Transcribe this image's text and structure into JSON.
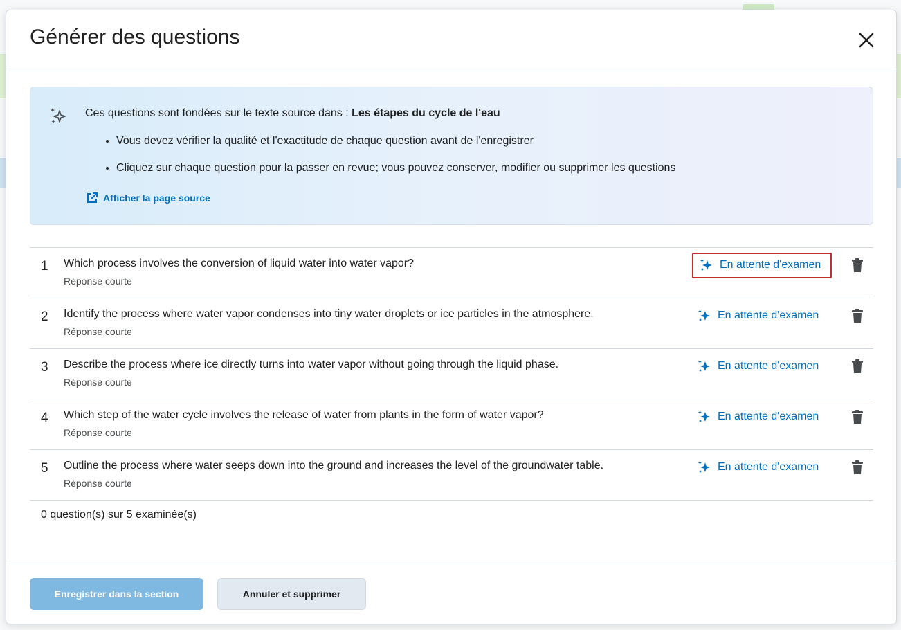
{
  "dialog": {
    "title": "Générer des questions",
    "close_label": "×"
  },
  "notice": {
    "intro": "Ces questions sont fondées sur le texte source dans : ",
    "source_name": "Les étapes du cycle de l'eau",
    "bullets": [
      "Vous devez vérifier la qualité et l'exactitude de chaque question avant de l'enregistrer",
      "Cliquez sur chaque question pour la passer en revue; vous pouvez conserver, modifier ou supprimer les questions"
    ],
    "source_link": "Afficher la page source"
  },
  "questions": [
    {
      "number": "1",
      "text": "Which process involves the conversion of liquid water into water vapor?",
      "type": "Réponse courte",
      "status": "En attente d'examen"
    },
    {
      "number": "2",
      "text": "Identify the process where water vapor condenses into tiny water droplets or ice particles in the atmosphere.",
      "type": "Réponse courte",
      "status": "En attente d'examen"
    },
    {
      "number": "3",
      "text": "Describe the process where ice directly turns into water vapor without going through the liquid phase.",
      "type": "Réponse courte",
      "status": "En attente d'examen"
    },
    {
      "number": "4",
      "text": "Which step of the water cycle involves the release of water from plants in the form of water vapor?",
      "type": "Réponse courte",
      "status": "En attente d'examen"
    },
    {
      "number": "5",
      "text": "Outline the process where water seeps down into the ground and increases the level of the groundwater table.",
      "type": "Réponse courte",
      "status": "En attente d'examen"
    }
  ],
  "summary": "0 question(s) sur 5 examinée(s)",
  "footer": {
    "save_label": "Enregistrer dans la section",
    "cancel_label": "Annuler et supprimer"
  },
  "colors": {
    "accent": "#006fbf",
    "highlight_border": "#c42e2e",
    "primary_button": "#7fb8e1"
  },
  "icons": {
    "notice": "sparkle-outline-icon",
    "status": "sparkle-icon",
    "delete": "trash-icon",
    "close": "close-icon",
    "external": "external-link-icon"
  }
}
